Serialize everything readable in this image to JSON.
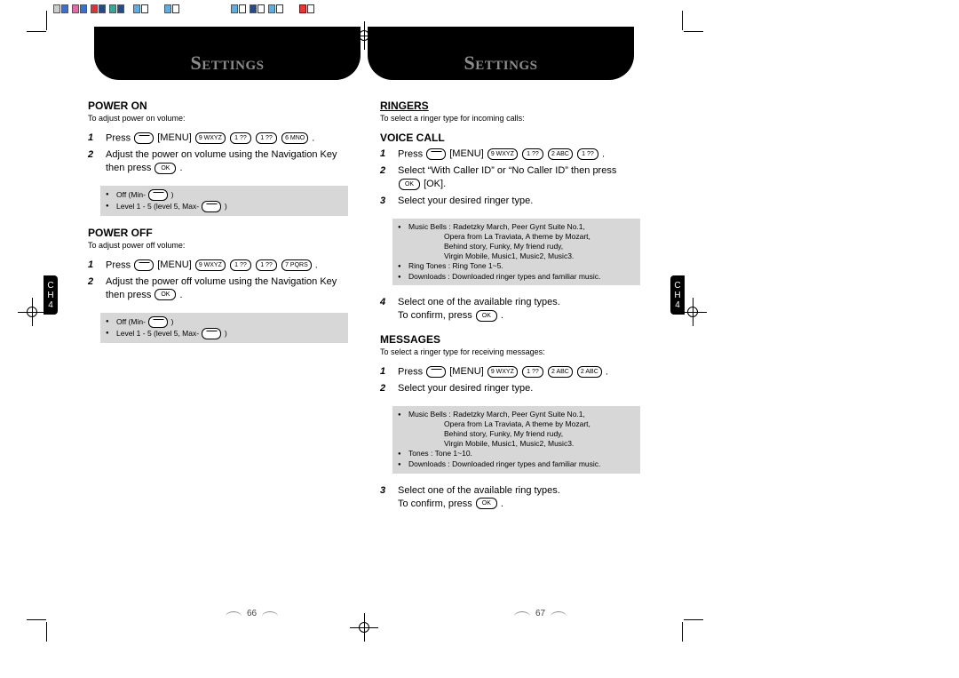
{
  "chapter": {
    "letter1": "C",
    "letter2": "H",
    "number": "4"
  },
  "header": {
    "title": "Settings"
  },
  "left": {
    "folio": "66",
    "power_on": {
      "heading": "POWER ON",
      "intro": "To adjust power on volume:",
      "step1_pre": "Press",
      "step1_menu": "[MENU]",
      "step1_keys": [
        "9 WXYZ",
        "1 ??",
        "1 ??",
        "6 MNO"
      ],
      "step2": "Adjust the power on volume using the Navigation Key then press ",
      "step2_ok": "OK",
      "info1_label": "Off (Min-",
      "info1_tail": ")",
      "info2_label": "Level 1 - 5 (level 5, Max-",
      "info2_tail": ")"
    },
    "power_off": {
      "heading": "POWER OFF",
      "intro": "To adjust power off volume:",
      "step1_pre": "Press",
      "step1_menu": "[MENU]",
      "step1_keys": [
        "9 WXYZ",
        "1 ??",
        "1 ??",
        "7 PQRS"
      ],
      "step2": "Adjust the power off volume using the Navigation Key then press ",
      "step2_ok": "OK",
      "info1_label": "Off (Min-",
      "info1_tail": ")",
      "info2_label": "Level 1 - 5 (level 5, Max-",
      "info2_tail": ")"
    }
  },
  "right": {
    "folio": "67",
    "ringers": {
      "heading": "RINGERS",
      "intro": "To select a ringer type for incoming calls:"
    },
    "voice": {
      "heading": "VOICE CALL",
      "step1_pre": "Press",
      "step1_menu": "[MENU]",
      "step1_keys": [
        "9 WXYZ",
        "1 ??",
        "2 ABC",
        "1 ??"
      ],
      "step2": "Select “With Caller ID” or “No Caller ID” then press ",
      "step2_ok_lbl": "[OK].",
      "step3": "Select your desired ringer type.",
      "info": {
        "r1": "Music Bells : Radetzky March, Peer Gynt Suite No.1,",
        "r1b": "Opera from La Traviata, A theme by Mozart,",
        "r1c": "Behind story, Funky, My friend rudy,",
        "r1d": "Virgin Mobile, Music1, Music2, Music3.",
        "r2": "Ring Tones : Ring Tone 1~5.",
        "r3": "Downloads : Downloaded ringer types and familiar music."
      },
      "step4a": "Select one of the available ring types.",
      "step4b": "To confirm, press "
    },
    "messages": {
      "heading": "MESSAGES",
      "intro": "To select a ringer type for receiving messages:",
      "step1_pre": "Press",
      "step1_menu": "[MENU]",
      "step1_keys": [
        "9 WXYZ",
        "1 ??",
        "2 ABC",
        "2 ABC"
      ],
      "step2": "Select your desired ringer type.",
      "info": {
        "r1": "Music Bells : Radetzky March, Peer Gynt Suite No.1,",
        "r1b": "Opera from La Traviata, A theme by Mozart,",
        "r1c": "Behind story, Funky, My friend rudy,",
        "r1d": "Virgin Mobile, Music1, Music2, Music3.",
        "r2": "Tones : Tone 1~10.",
        "r3": "Downloads : Downloaded ringer types and familiar music."
      },
      "step3a": "Select one of the available ring types.",
      "step3b": "To confirm, press "
    }
  }
}
